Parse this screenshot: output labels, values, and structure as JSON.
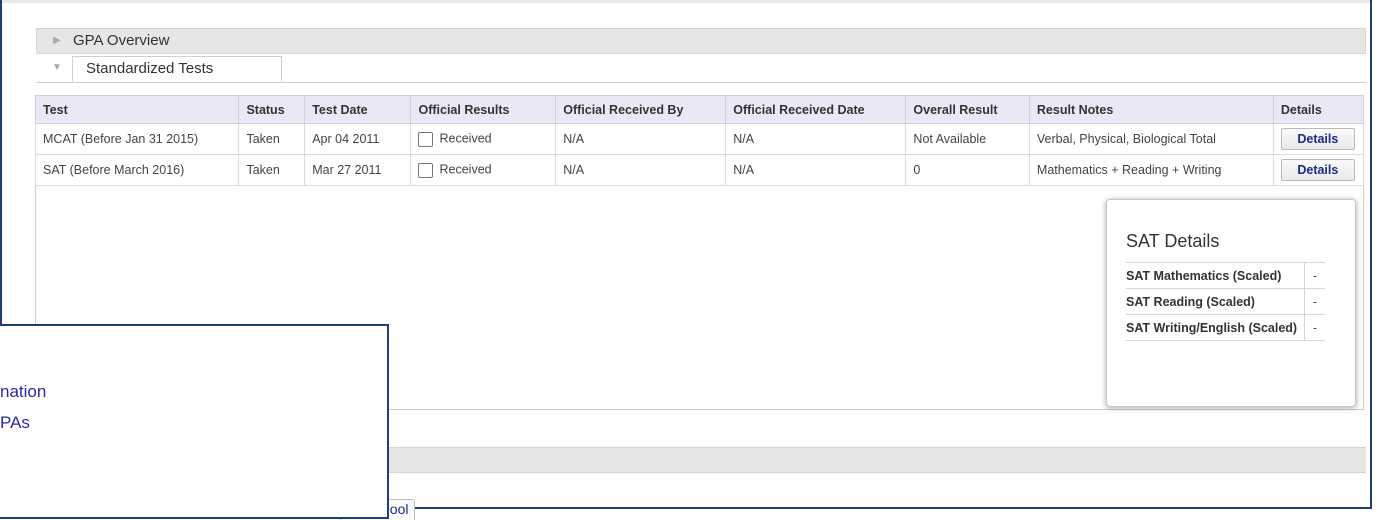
{
  "sections": {
    "gpa_overview": "GPA Overview",
    "standardized_tests": "Standardized Tests"
  },
  "tests_table": {
    "headers": [
      "Test",
      "Status",
      "Test Date",
      "Official Results",
      "Official Received By",
      "Official Received Date",
      "Overall Result",
      "Result Notes",
      "Details"
    ],
    "rows": [
      {
        "test": "MCAT (Before Jan 31 2015)",
        "status": "Taken",
        "test_date": "Apr 04 2011",
        "official_results": "Received",
        "official_results_checked": false,
        "received_by": "N/A",
        "received_date": "N/A",
        "overall_result": "Not Available",
        "result_notes": "Verbal, Physical, Biological Total",
        "details_label": "Details"
      },
      {
        "test": "SAT (Before March 2016)",
        "status": "Taken",
        "test_date": "Mar 27 2011",
        "official_results": "Received",
        "official_results_checked": false,
        "received_by": "N/A",
        "received_date": "N/A",
        "overall_result": "0",
        "result_notes": "Mathematics + Reading + Writing",
        "details_label": "Details"
      }
    ]
  },
  "sat_popup": {
    "title": "SAT Details",
    "rows": [
      {
        "label": "SAT Mathematics (Scaled)",
        "value": "-"
      },
      {
        "label": "SAT Reading (Scaled)",
        "value": "-"
      },
      {
        "label": "SAT Writing/English (Scaled)",
        "value": "-"
      }
    ]
  },
  "menu_overlay": {
    "items": [
      "nation",
      "PAs"
    ]
  },
  "bottom_tab": {
    "label": "chool"
  },
  "colors": {
    "frame_border": "#1f3d7a",
    "header_bg": "#e8e9f5",
    "link_blue": "#1a2c8a",
    "menu_link": "#2a2aa6"
  }
}
